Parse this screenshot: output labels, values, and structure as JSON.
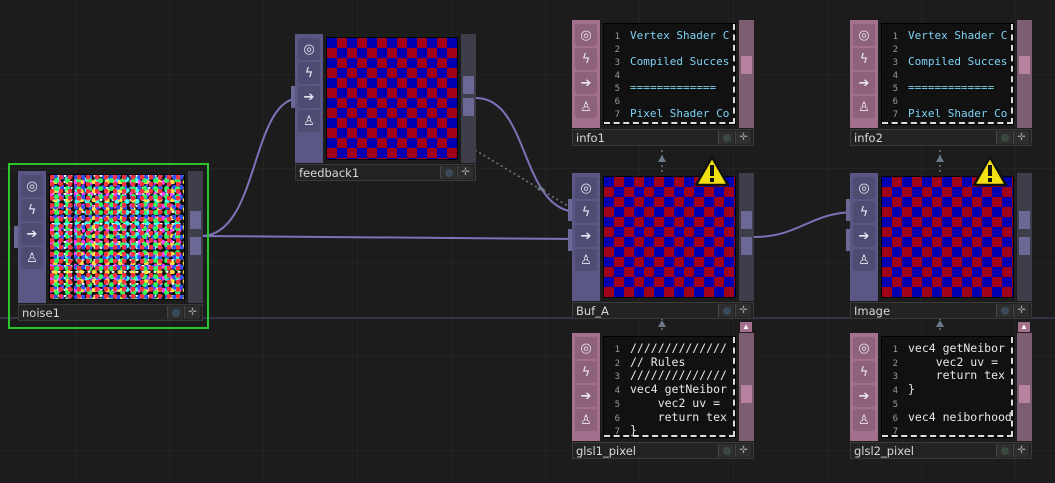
{
  "nodes": {
    "noise1": {
      "name": "noise1",
      "sidebar_icons": [
        "target-icon",
        "lightning-icon",
        "arrow-right-icon",
        "lock-icon"
      ]
    },
    "feedback1": {
      "name": "feedback1"
    },
    "info1": {
      "name": "info1",
      "lines": [
        {
          "n": "1",
          "text": "Vertex Shader C"
        },
        {
          "n": "2",
          "text": ""
        },
        {
          "n": "3",
          "text": "Compiled Succes"
        },
        {
          "n": "4",
          "text": ""
        },
        {
          "n": "5",
          "text": "============="
        },
        {
          "n": "6",
          "text": ""
        },
        {
          "n": "7",
          "text": "Pixel Shader Co"
        }
      ]
    },
    "info2": {
      "name": "info2",
      "lines": [
        {
          "n": "1",
          "text": "Vertex Shader C"
        },
        {
          "n": "2",
          "text": ""
        },
        {
          "n": "3",
          "text": "Compiled Succes"
        },
        {
          "n": "4",
          "text": ""
        },
        {
          "n": "5",
          "text": "============="
        },
        {
          "n": "6",
          "text": ""
        },
        {
          "n": "7",
          "text": "Pixel Shader Co"
        }
      ]
    },
    "buf_a": {
      "name": "Buf_A",
      "warning": "warning-icon"
    },
    "image": {
      "name": "Image",
      "warning": "warning-icon"
    },
    "glsl1_pixel": {
      "name": "glsl1_pixel",
      "lines": [
        {
          "n": "1",
          "text": "//////////////"
        },
        {
          "n": "2",
          "text": "// Rules"
        },
        {
          "n": "3",
          "text": "//////////////"
        },
        {
          "n": "4",
          "text": "vec4 getNeibor"
        },
        {
          "n": "5",
          "text": "    vec2 uv ="
        },
        {
          "n": "6",
          "text": "    return tex"
        },
        {
          "n": "7",
          "text": "}"
        }
      ]
    },
    "glsl2_pixel": {
      "name": "glsl2_pixel",
      "lines": [
        {
          "n": "1",
          "text": "vec4 getNeibor"
        },
        {
          "n": "2",
          "text": "    vec2 uv ="
        },
        {
          "n": "3",
          "text": "    return tex"
        },
        {
          "n": "4",
          "text": "}"
        },
        {
          "n": "5",
          "text": ""
        },
        {
          "n": "6",
          "text": "vec4 neiborhood"
        },
        {
          "n": "7",
          "text": ""
        }
      ]
    }
  },
  "colors": {
    "top_node_sidebar": "#5a5785",
    "dat_node_sidebar": "#a3708e",
    "wire": "#7b74b8",
    "selected_border": "#2cc52c",
    "background": "#1c1c1c",
    "info_text": "#7ed3f4"
  },
  "icons": {
    "target": "◎",
    "lightning": "ϟ",
    "arrow": "➔",
    "lock": "🔒",
    "add": "+"
  }
}
